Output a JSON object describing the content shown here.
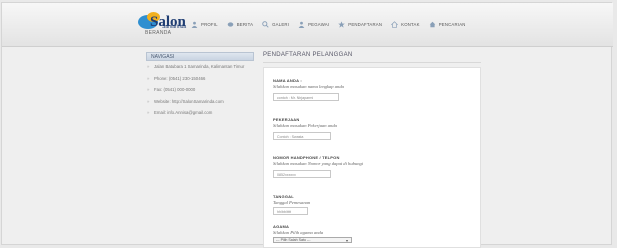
{
  "brand": {
    "logo_text": "Salon",
    "logo_tagline": "Samarinda",
    "subtitle": "BERANDA"
  },
  "nav": [
    {
      "label": "PROFIL",
      "icon": "person-icon"
    },
    {
      "label": "BERITA",
      "icon": "news-icon"
    },
    {
      "label": "GALERI",
      "icon": "search-icon"
    },
    {
      "label": "PEGAWAI",
      "icon": "person-icon"
    },
    {
      "label": "PENDAFTARAN",
      "icon": "star-icon"
    },
    {
      "label": "KONTAK",
      "icon": "home-icon"
    },
    {
      "label": "PENCARIAN",
      "icon": "search-icon"
    }
  ],
  "sidebar": {
    "title": "NAVIGASI",
    "items": [
      "Jalan Batubara 1 Samarinda, Kalimantan Timur",
      "Phone: (0541) 230-150466",
      "Fax: (0541) 000-0000",
      "Website: http://SalonSamarinda.com",
      "Email: info.Annisa@gmail.com"
    ]
  },
  "form": {
    "title": "PENDAFTARAN PELANGGAN",
    "fields": [
      {
        "label": "NAMA ANDA :",
        "hint": "Silahkan masukan nama lengkap anda",
        "placeholder": "contoh : Mr. Nirjaparmi"
      },
      {
        "label": "PEKERJAAN",
        "hint": "Silahkan masukan Pekerjaan anda",
        "placeholder": "Contoh : Swasta"
      },
      {
        "label": "NOMOR HANDPHONE / TELPON",
        "hint": "Silahkan masukan Nomor yang dapat di hubungi",
        "placeholder": "0852xxxxxx"
      },
      {
        "label": "TANGGAL",
        "hint": "Tanggal Pemesanan",
        "placeholder": "hh/bb/tttt"
      },
      {
        "label": "AGAMA",
        "hint": "Silahkan Pilih agama anda",
        "select_value": "--- Pilih Salah Satu ---"
      }
    ]
  },
  "colors": {
    "accent": "#2f8fd0",
    "brand_yellow": "#f2b01e",
    "sidebar_title_bg": "#c9d4e2"
  }
}
